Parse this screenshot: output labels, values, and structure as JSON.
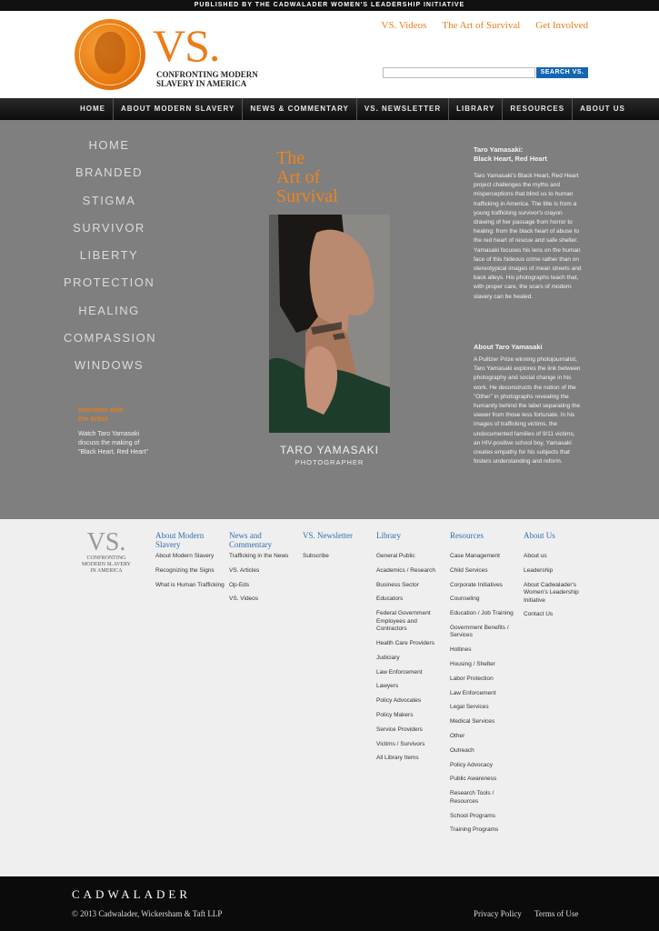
{
  "topbar": "PUBLISHED BY THE CADWALADER WOMEN'S LEADERSHIP INITIATIVE",
  "header": {
    "logo": "VS.",
    "tagline_1": "CONFRONTING MODERN",
    "tagline_2": "SLAVERY IN AMERICA",
    "links": [
      "VS. Videos",
      "The Art of Survival",
      "Get Involved"
    ],
    "search_button": "SEARCH VS."
  },
  "nav": [
    "HOME",
    "ABOUT MODERN SLAVERY",
    "NEWS & COMMENTARY",
    "VS. NEWSLETTER",
    "LIBRARY",
    "RESOURCES",
    "ABOUT US"
  ],
  "leftnav": [
    "HOME",
    "BRANDED",
    "STIGMA",
    "SURVIVOR",
    "LIBERTY",
    "PROTECTION",
    "HEALING",
    "COMPASSION",
    "WINDOWS"
  ],
  "interview": {
    "title_1": "Interview with",
    "title_2": "the Artist",
    "text": "Watch Taro Yamasaki discuss the making of \"Black Heart, Red Heart\""
  },
  "feature": {
    "title_1": "The",
    "title_2": "Art of",
    "title_3": "Survival",
    "name": "TARO YAMASAKI",
    "role": "PHOTOGRAPHER"
  },
  "right": {
    "heading_1": "Taro Yamasaki:",
    "heading_2": "Black Heart, Red Heart",
    "body": "Taro Yamasaki's Black Heart, Red Heart project challenges the myths and misperceptions that blind us to human trafficking in America. The title is from a young trafficking survivor's crayon drawing of her passage from horror to healing: from the black heart of abuse to the red heart of rescue and safe shelter. Yamasaki focuses his lens on the human face of this hideous crime rather than on stereotypical images of mean streets and back alleys. His photographs teach that, with proper care, the scars of modern slavery can be healed.",
    "about_heading": "About Taro Yamasaki",
    "about_body": "A Pulitzer Prize winning photojournalist, Taro Yamasaki explores the link between photography and social change in his work. He deconstructs the notion of the \"Other\" in photographs revealing the humanity behind the label separating the viewer from those less fortunate. In his images of trafficking victims, the undocumented families of 9/11 victims, an HIV-positive school boy, Yamasaki creates empathy for his subjects that fosters understanding and reform."
  },
  "footer": {
    "logo": "VS.",
    "tagline": "CONFRONTING MODERN SLAVERY IN AMERICA",
    "columns": [
      {
        "title": "About Modern Slavery",
        "items": [
          "About Modern Slavery",
          "Recognizing the Signs",
          "What is Human Trafficking"
        ]
      },
      {
        "title": "News and Commentary",
        "items": [
          "Trafficking in the News",
          "VS. Articles",
          "Op-Eds",
          "VS. Videos"
        ]
      },
      {
        "title": "VS. Newsletter",
        "items": [
          "Subscribe"
        ]
      },
      {
        "title": "Library",
        "items": [
          "General Public",
          "Academics / Research",
          "Business Sector",
          "Educators",
          "Federal Government Employees and Contractors",
          "Health Care Providers",
          "Judiciary",
          "Law Enforcement",
          "Lawyers",
          "Policy Advocates",
          "Policy Makers",
          "Service Providers",
          "Victims / Survivors",
          "All Library Items"
        ]
      },
      {
        "title": "Resources",
        "items": [
          "Case Management",
          "Child Services",
          "Corporate Initiatives",
          "Counseling",
          "Education / Job Training",
          "Government Benefits / Services",
          "Hotlines",
          "Housing / Shelter",
          "Labor Protection",
          "Law Enforcement",
          "Legal Services",
          "Medical Services",
          "Other",
          "Outreach",
          "Policy Advocacy",
          "Public Awareness",
          "Research Tools / Resources",
          "School Programs",
          "Training Programs"
        ]
      },
      {
        "title": "About Us",
        "items": [
          "About us",
          "Leadership",
          "About Cadwalader's Women's Leadership Initiative",
          "Contact Us"
        ]
      }
    ]
  },
  "bottom": {
    "brand": "CADWALADER",
    "copyright": "© 2013 Cadwalader, Wickersham & Taft LLP",
    "privacy": "Privacy Policy",
    "terms": "Terms of Use"
  }
}
